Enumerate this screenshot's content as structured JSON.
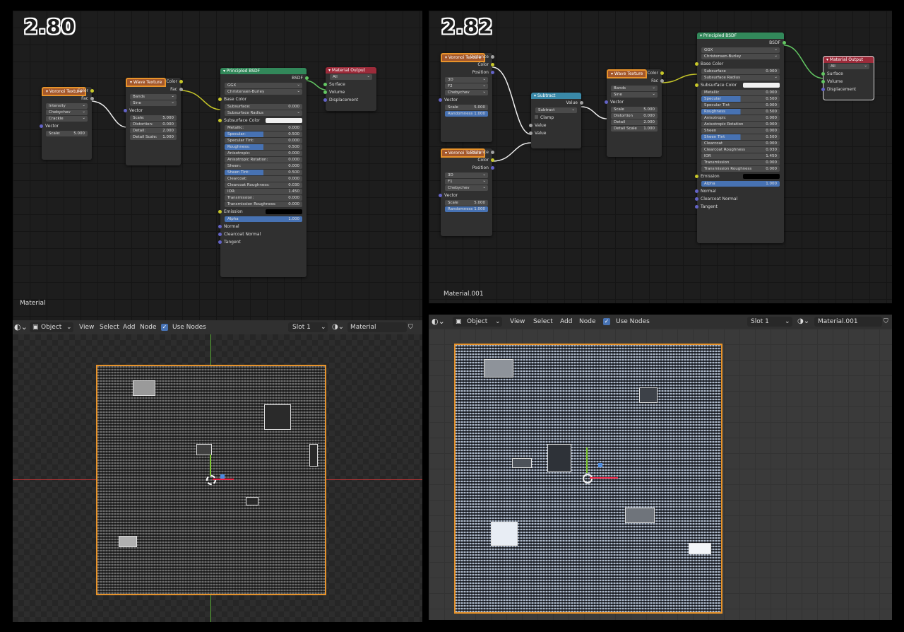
{
  "left": {
    "version": "2.80",
    "material_label": "Material",
    "nodes": {
      "voronoi": {
        "title": "Voronoi Texture",
        "out_color": "Color",
        "out_fac": "Fac",
        "dd1": "Intensity",
        "dd2": "Chebychev",
        "dd3": "Crackle",
        "in_vector": "Vector",
        "scale_label": "Scale:",
        "scale_value": "5.000"
      },
      "wave": {
        "title": "Wave Texture",
        "out_color": "Color",
        "out_fac": "Fac",
        "dd1": "Bands",
        "dd2": "Sine",
        "in_vector": "Vector",
        "scale_label": "Scale:",
        "scale_value": "5.000",
        "distortion_label": "Distortion:",
        "distortion_value": "0.000",
        "detail_label": "Detail:",
        "detail_value": "2.000",
        "detail_scale_label": "Detail Scale:",
        "detail_scale_value": "1.000"
      },
      "bsdf": {
        "title": "Principled BSDF",
        "out": "BSDF",
        "dd1": "GGX",
        "dd2": "Christensen-Burley",
        "base_color": "Base Color",
        "fields": [
          {
            "label": "Subsurface:",
            "value": "0.000",
            "fill": 0
          },
          {
            "label": "Subsurface Radius",
            "value": "",
            "fill": 0,
            "dropdown": true
          },
          {
            "label": "Subsurface Color",
            "value": "",
            "fill": 0,
            "swatch": "#f0f0f0"
          },
          {
            "label": "Metallic:",
            "value": "0.000",
            "fill": 0
          },
          {
            "label": "Specular:",
            "value": "0.500",
            "fill": 50
          },
          {
            "label": "Specular Tint:",
            "value": "0.000",
            "fill": 0
          },
          {
            "label": "Roughness:",
            "value": "0.500",
            "fill": 50
          },
          {
            "label": "Anisotropic:",
            "value": "0.000",
            "fill": 0
          },
          {
            "label": "Anisotropic Rotation:",
            "value": "0.000",
            "fill": 0
          },
          {
            "label": "Sheen:",
            "value": "0.000",
            "fill": 0
          },
          {
            "label": "Sheen Tint:",
            "value": "0.500",
            "fill": 50
          },
          {
            "label": "Clearcoat:",
            "value": "0.000",
            "fill": 0
          },
          {
            "label": "Clearcoat Roughness:",
            "value": "0.030",
            "fill": 0
          },
          {
            "label": "IOR:",
            "value": "1.450",
            "fill": 0
          },
          {
            "label": "Transmission:",
            "value": "0.000",
            "fill": 0
          },
          {
            "label": "Transmission Roughness:",
            "value": "0.000",
            "fill": 0
          }
        ],
        "emission": "Emission",
        "emission_color": "#000000",
        "alpha_label": "Alpha",
        "alpha_value": "1.000",
        "normal": "Normal",
        "clearcoat_normal": "Clearcoat Normal",
        "tangent": "Tangent"
      },
      "output": {
        "title": "Material Output",
        "dd": "All",
        "surface": "Surface",
        "volume": "Volume",
        "displacement": "Displacement"
      }
    },
    "header": {
      "mode": "Object",
      "view": "View",
      "select": "Select",
      "add": "Add",
      "node": "Node",
      "use_nodes": "Use Nodes",
      "slot": "Slot 1",
      "material": "Material"
    }
  },
  "right": {
    "version": "2.82",
    "material_label": "Material.001",
    "nodes": {
      "voronoi1": {
        "title": "Voronoi Texture",
        "out_distance": "Distance",
        "out_color": "Color",
        "out_position": "Position",
        "dd1": "3D",
        "dd2": "F2",
        "dd3": "Chebychev",
        "in_vector": "Vector",
        "scale_label": "Scale",
        "scale_value": "5.000",
        "rand_label": "Randomness",
        "rand_value": "1.000"
      },
      "voronoi2": {
        "title": "Voronoi Texture",
        "out_distance": "Distance",
        "out_color": "Color",
        "out_position": "Position",
        "dd1": "3D",
        "dd2": "F1",
        "dd3": "Chebychev",
        "in_vector": "Vector",
        "scale_label": "Scale",
        "scale_value": "5.000",
        "rand_label": "Randomness",
        "rand_value": "1.000"
      },
      "subtract": {
        "title": "Subtract",
        "out": "Value",
        "dd": "Subtract",
        "clamp": "Clamp",
        "in1": "Value",
        "in2": "Value"
      },
      "wave": {
        "title": "Wave Texture",
        "out_color": "Color",
        "out_fac": "Fac",
        "dd1": "Bands",
        "dd2": "Sine",
        "in_vector": "Vector",
        "scale_label": "Scale",
        "scale_value": "5.000",
        "distortion_label": "Distortion",
        "distortion_value": "0.000",
        "detail_label": "Detail",
        "detail_value": "2.000",
        "detail_scale_label": "Detail Scale",
        "detail_scale_value": "1.000"
      },
      "bsdf": {
        "title": "Principled BSDF",
        "out": "BSDF",
        "dd1": "GGX",
        "dd2": "Christensen-Burley",
        "base_color": "Base Color",
        "fields": [
          {
            "label": "Subsurface",
            "value": "0.000",
            "fill": 0
          },
          {
            "label": "Subsurface Radius",
            "value": "",
            "fill": 0,
            "dropdown": true
          },
          {
            "label": "Subsurface Color",
            "value": "",
            "fill": 0,
            "swatch": "#f0f0f0"
          },
          {
            "label": "Metallic",
            "value": "0.000",
            "fill": 0
          },
          {
            "label": "Specular",
            "value": "0.500",
            "fill": 50
          },
          {
            "label": "Specular Tint",
            "value": "0.000",
            "fill": 0
          },
          {
            "label": "Roughness",
            "value": "0.500",
            "fill": 50
          },
          {
            "label": "Anisotropic",
            "value": "0.000",
            "fill": 0
          },
          {
            "label": "Anisotropic Rotation",
            "value": "0.000",
            "fill": 0
          },
          {
            "label": "Sheen",
            "value": "0.000",
            "fill": 0
          },
          {
            "label": "Sheen Tint",
            "value": "0.500",
            "fill": 50
          },
          {
            "label": "Clearcoat",
            "value": "0.000",
            "fill": 0
          },
          {
            "label": "Clearcoat Roughness",
            "value": "0.030",
            "fill": 0
          },
          {
            "label": "IOR",
            "value": "1.450",
            "fill": 0
          },
          {
            "label": "Transmission",
            "value": "0.000",
            "fill": 0
          },
          {
            "label": "Transmission Roughness",
            "value": "0.000",
            "fill": 0
          }
        ],
        "emission": "Emission",
        "emission_color": "#000000",
        "alpha_label": "Alpha",
        "alpha_value": "1.000",
        "normal": "Normal",
        "clearcoat_normal": "Clearcoat Normal",
        "tangent": "Tangent"
      },
      "output": {
        "title": "Material Output",
        "dd": "All",
        "surface": "Surface",
        "volume": "Volume",
        "displacement": "Displacement"
      }
    },
    "header": {
      "mode": "Object",
      "view": "View",
      "select": "Select",
      "add": "Add",
      "node": "Node",
      "use_nodes": "Use Nodes",
      "slot": "Slot 1",
      "material": "Material.001"
    }
  },
  "colors": {
    "texture_node": "#a4582c",
    "shader_node": "#32885a",
    "output_node": "#9c2b3a",
    "converter_node": "#3a89a8",
    "selection_outline": "#e8932a",
    "slider_blue": "#4772b3"
  }
}
